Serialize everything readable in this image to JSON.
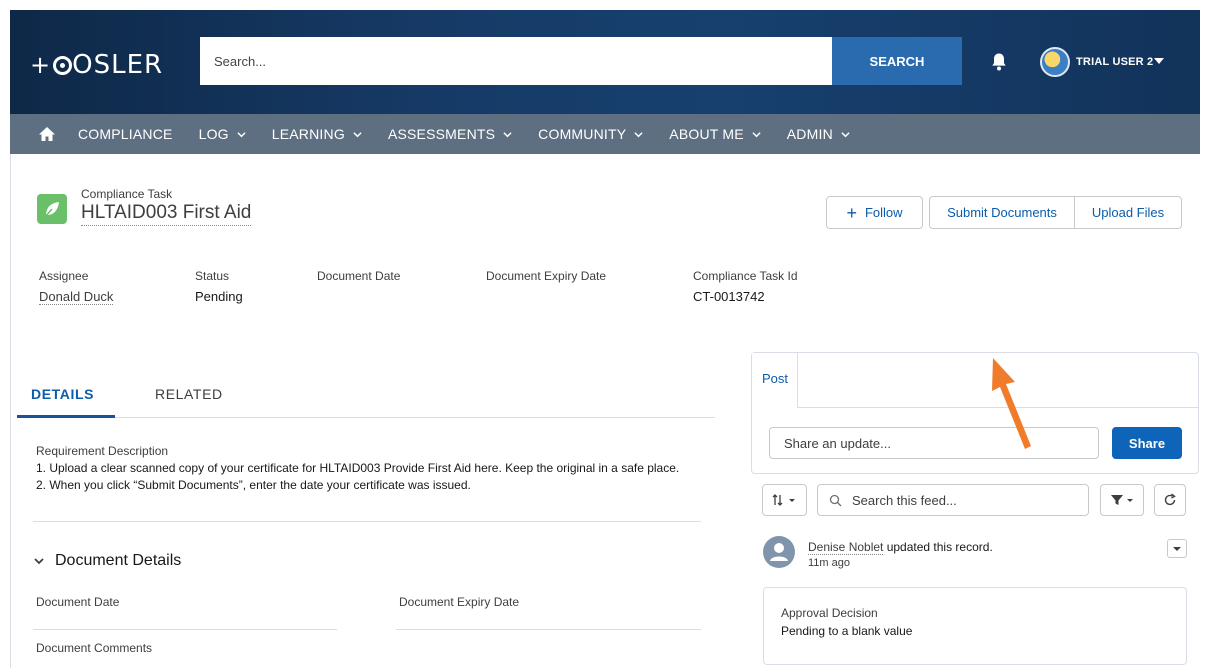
{
  "header": {
    "logo": "OSLER",
    "search_placeholder": "Search...",
    "search_button": "SEARCH",
    "user_name": "TRIAL USER 2"
  },
  "nav": {
    "items": [
      {
        "label": "COMPLIANCE",
        "dropdown": false
      },
      {
        "label": "LOG",
        "dropdown": true
      },
      {
        "label": "LEARNING",
        "dropdown": true
      },
      {
        "label": "ASSESSMENTS",
        "dropdown": true
      },
      {
        "label": "COMMUNITY",
        "dropdown": true
      },
      {
        "label": "ABOUT ME",
        "dropdown": true
      },
      {
        "label": "ADMIN",
        "dropdown": true
      }
    ]
  },
  "record": {
    "type": "Compliance Task",
    "title": "HLTAID003 First Aid",
    "icon_color": "#6ac069",
    "buttons": {
      "follow": "Follow",
      "submit_documents": "Submit Documents",
      "upload_files": "Upload Files"
    },
    "highlights": [
      {
        "label": "Assignee",
        "value": "Donald Duck"
      },
      {
        "label": "Status",
        "value": "Pending"
      },
      {
        "label": "Document Date",
        "value": ""
      },
      {
        "label": "Document Expiry Date",
        "value": ""
      },
      {
        "label": "Compliance Task Id",
        "value": "CT-0013742"
      }
    ]
  },
  "tabs": {
    "details": "DETAILS",
    "related": "RELATED",
    "active": "DETAILS"
  },
  "details": {
    "requirement_label": "Requirement Description",
    "requirement_line1": "1. Upload a clear scanned copy of your certificate for HLTAID003 Provide First Aid here. Keep the original in a safe place.",
    "requirement_line2": "2. When you click “Submit Documents”, enter the date your certificate was issued.",
    "section_title": "Document Details",
    "field_document_date": "Document Date",
    "field_document_expiry": "Document Expiry Date",
    "field_document_comments": "Document Comments"
  },
  "feed": {
    "post_tab": "Post",
    "share_placeholder": "Share an update...",
    "share_button": "Share",
    "search_placeholder": "Search this feed...",
    "item": {
      "actor": "Denise Noblet",
      "action": " updated this record.",
      "time": "11m ago",
      "change_title": "Approval Decision",
      "change_value": "Pending to a blank value"
    }
  },
  "colors": {
    "header_bg": "#163a66",
    "nav_bg": "#5f6f82",
    "search_button": "#2a6bb0",
    "share_button": "#0e64b8",
    "annotation_arrow": "#f07c2b"
  },
  "icons": [
    "home-icon",
    "chevron-down-icon",
    "bell-icon",
    "leaf-icon",
    "plus-icon",
    "sort-icon",
    "search-icon",
    "filter-icon",
    "refresh-icon",
    "user-avatar-icon"
  ]
}
